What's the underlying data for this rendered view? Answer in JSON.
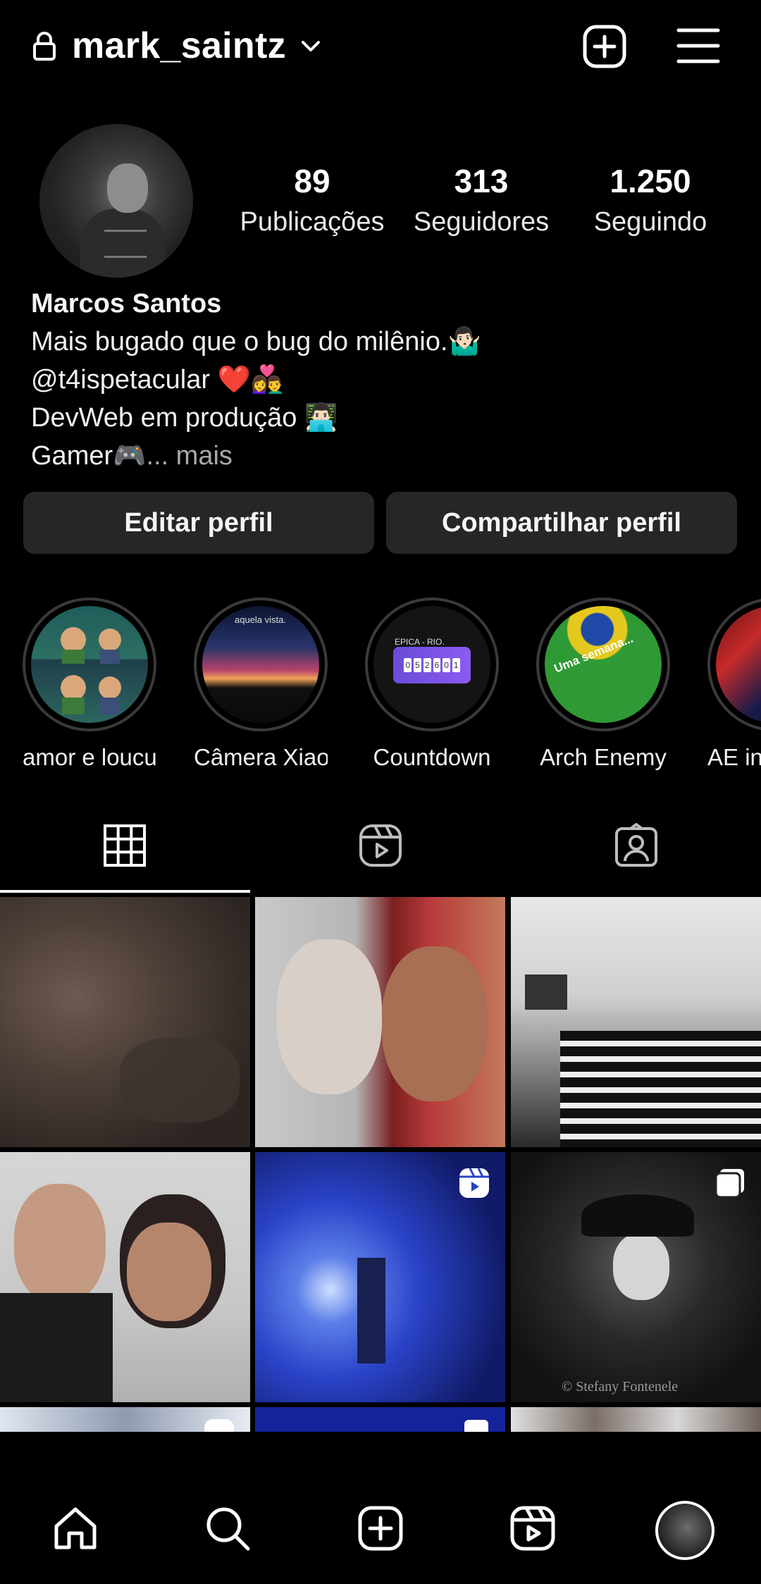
{
  "header": {
    "username": "mark_saintz",
    "lock_icon": "lock-icon",
    "dropdown_icon": "chevron-down-icon",
    "create_icon": "plus-square-icon",
    "menu_icon": "hamburger-menu-icon"
  },
  "profile": {
    "stats": [
      {
        "value": "89",
        "label": "Publicações"
      },
      {
        "value": "313",
        "label": "Seguidores"
      },
      {
        "value": "1.250",
        "label": "Seguindo"
      }
    ],
    "name": "Marcos Santos",
    "bio_lines": [
      "Mais bugado que o bug do milênio.🤷🏻‍♂️",
      "@t4ispetacular ❤️👩‍❤️‍👨",
      "DevWeb em produção 👨🏻‍💻",
      "Gamer🎮"
    ],
    "bio_more": "... mais"
  },
  "buttons": {
    "edit_profile": "Editar perfil",
    "share_profile": "Compartilhar perfil"
  },
  "highlights": [
    {
      "label": "amor e loucur..."
    },
    {
      "label": "Câmera Xiao..."
    },
    {
      "label": "Countdown"
    },
    {
      "label": "Arch Enemy"
    },
    {
      "label": "AE in B"
    }
  ],
  "highlight_texts": {
    "countdown_title": "EPICA - RIO.",
    "countdown_digits": [
      "0",
      "5",
      "2",
      "6",
      "0",
      "1"
    ],
    "arch_enemy_caption": "Uma semana...",
    "camera_caption": "aquela vista."
  },
  "tabs": [
    {
      "name": "grid",
      "icon": "grid-icon",
      "selected": true
    },
    {
      "name": "reels",
      "icon": "reels-icon",
      "selected": false
    },
    {
      "name": "tagged",
      "icon": "tagged-person-icon",
      "selected": false
    }
  ],
  "posts": [
    {
      "kind": "photo",
      "desc": "sleeping-couple"
    },
    {
      "kind": "photo",
      "desc": "couple-selfie"
    },
    {
      "kind": "photo",
      "desc": "bedroom"
    },
    {
      "kind": "photo",
      "desc": "couple-portrait"
    },
    {
      "kind": "reel",
      "badge": "reels-icon"
    },
    {
      "kind": "carousel",
      "badge": "carousel-icon",
      "watermark": "© Stefany Fontenele"
    },
    {
      "kind": "reel",
      "badge": "reels-icon"
    },
    {
      "kind": "carousel",
      "badge": "carousel-icon"
    },
    {
      "kind": "photo",
      "desc": "band-group"
    }
  ],
  "bottom_nav": [
    {
      "icon": "home-icon"
    },
    {
      "icon": "search-icon"
    },
    {
      "icon": "create-post-icon"
    },
    {
      "icon": "reels-icon"
    },
    {
      "icon": "profile-avatar"
    }
  ]
}
